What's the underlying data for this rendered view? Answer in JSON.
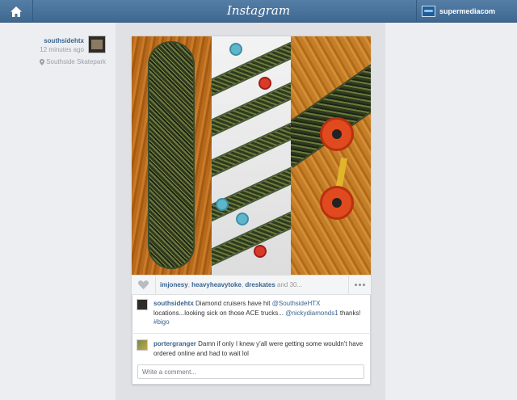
{
  "header": {
    "logo": "Instagram",
    "profile_name": "supermediacom"
  },
  "post": {
    "author": "southsidehtx",
    "time": "12 minutes ago",
    "location": "Southside Skatepark",
    "likes_users": [
      "imjonesy",
      "heavyheavytoke",
      "dreskates"
    ],
    "likes_more": "and 30..."
  },
  "comments": [
    {
      "user": "southsidehtx",
      "text_1": "Diamond cruisers have hit",
      "mention_1": "@SouthsideHTX",
      "text_2": "locations...looking sick on those ACE trucks...",
      "mention_2": "@nickydiamonds1",
      "text_3": "thanks!",
      "text_4": "#bigo"
    },
    {
      "user": "portergranger",
      "text": "Damn if only I knew y'all were getting some wouldn't have ordered online and had to wait lol"
    }
  ],
  "comment_input": {
    "placeholder": "Write a comment..."
  },
  "colors": {
    "header": "#4a739c",
    "link": "#3b6490",
    "background": "#eceef1"
  }
}
